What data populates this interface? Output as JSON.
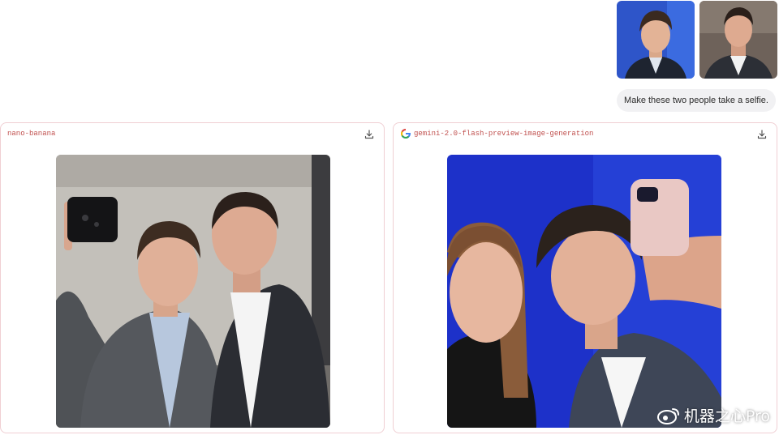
{
  "user_message": {
    "attachments": [
      {
        "icon": "portrait-photo-1"
      },
      {
        "icon": "portrait-photo-2"
      }
    ],
    "prompt": "Make these two people take a selfie."
  },
  "results": [
    {
      "model": "nano-banana",
      "download_icon": "download-icon"
    },
    {
      "model": "gemini-2.0-flash-preview-image-generation",
      "provider_icon": "google-g-icon",
      "download_icon": "download-icon"
    }
  ],
  "watermark": {
    "text": "机器之心Pro",
    "icon": "weibo-icon"
  },
  "colors": {
    "label": "#c0504e",
    "card_border": "#f0cfd3",
    "bubble_bg": "#f1f1f3",
    "blue_backdrop": "#1d31c9"
  }
}
